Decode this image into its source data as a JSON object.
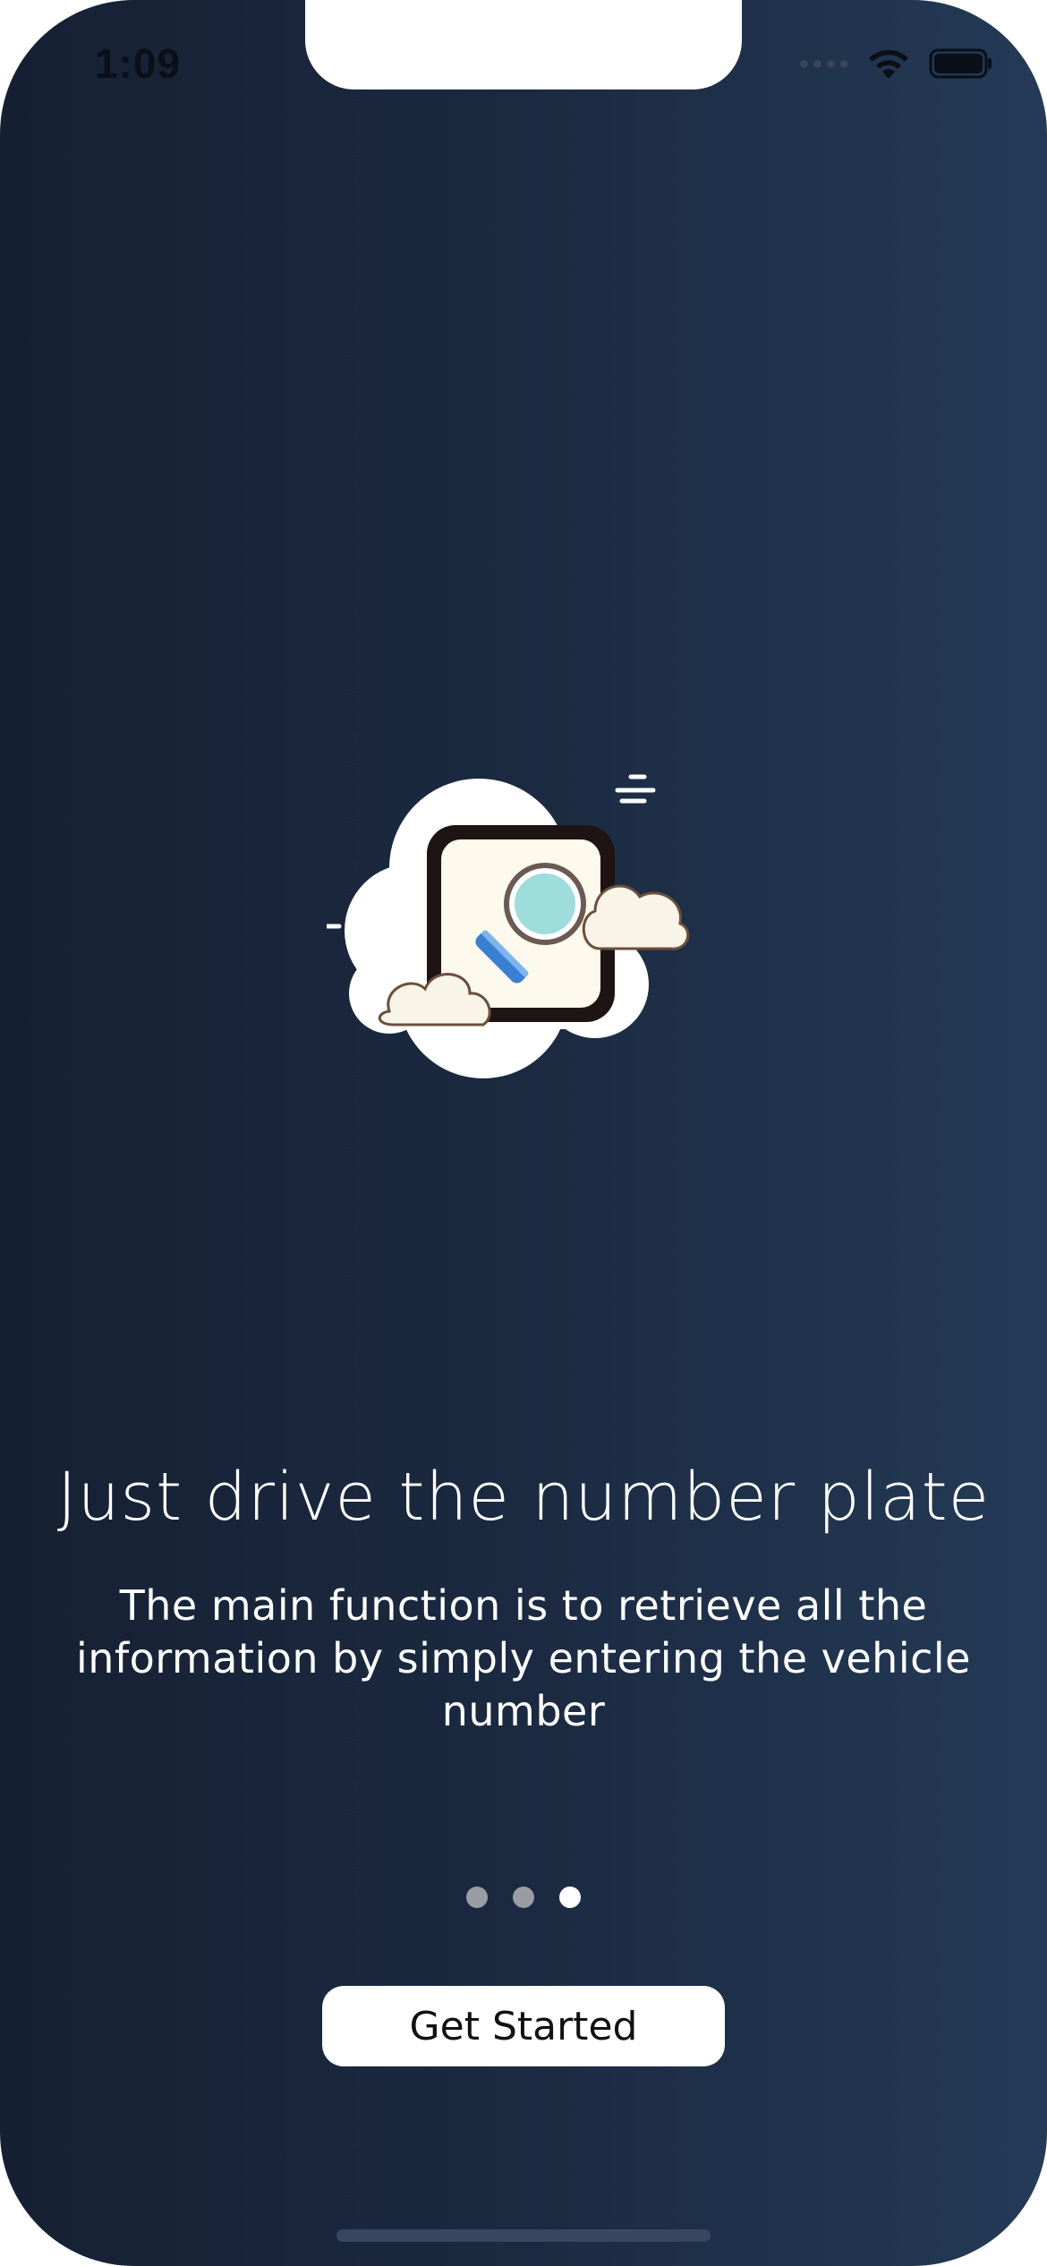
{
  "status_bar": {
    "time": "1:09",
    "wifi_icon": "wifi-icon",
    "battery_icon": "battery-icon"
  },
  "onboarding": {
    "illustration_icon": "cloud-search-plate-icon",
    "title": "Just drive the number plate",
    "description": "The main function is to retrieve all the information by simply entering the vehicle number",
    "page_indicator": {
      "total": 3,
      "current": 3
    },
    "cta_label": "Get Started"
  },
  "colors": {
    "background_start": "#162033",
    "background_end": "#243a56",
    "text": "#ffffff",
    "dot_inactive": "#9a9ca3",
    "dot_active": "#ffffff",
    "button_bg": "#ffffff",
    "button_text": "#111111"
  }
}
